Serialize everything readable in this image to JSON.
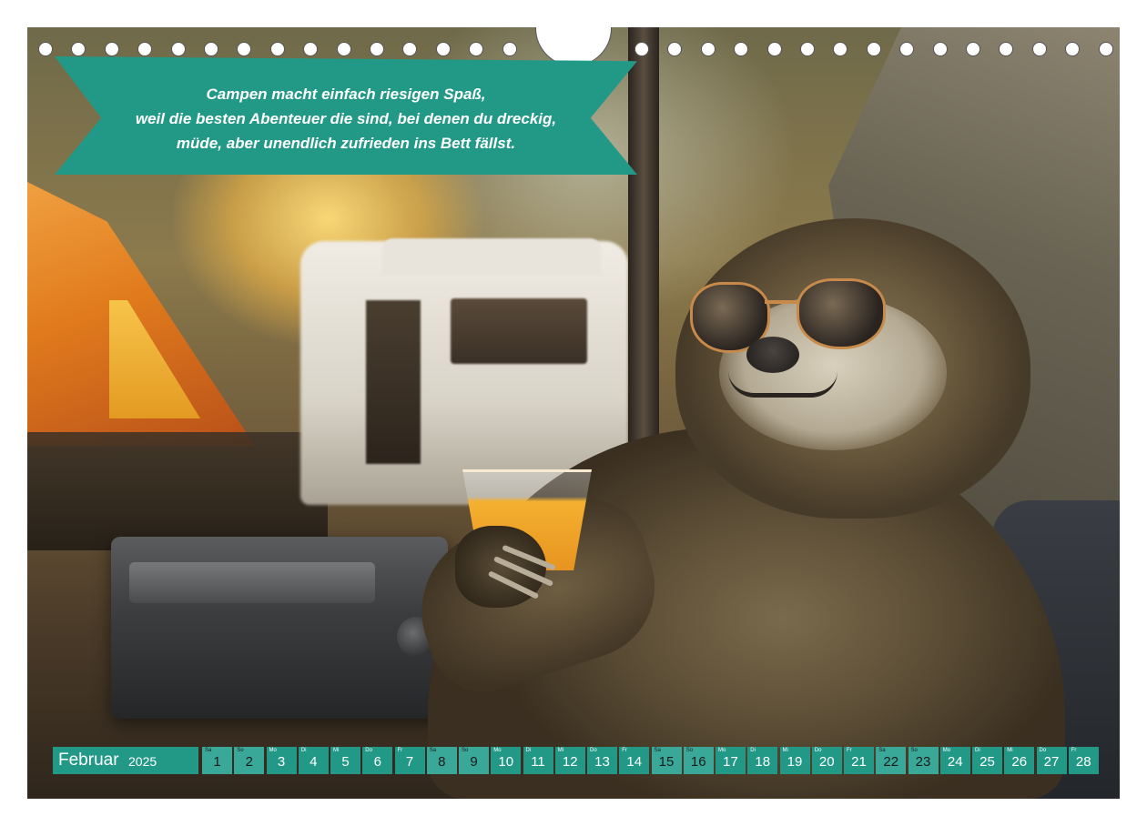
{
  "banner": {
    "lines": [
      "Campen macht einfach riesigen Spaß,",
      "weil die besten Abenteuer die sind, bei denen du dreckig,",
      "müde, aber unendlich zufrieden ins Bett fällst."
    ]
  },
  "calendar": {
    "month": "Februar",
    "year": "2025",
    "days": [
      {
        "wd": "Sa",
        "num": "1"
      },
      {
        "wd": "So",
        "num": "2"
      },
      {
        "wd": "Mo",
        "num": "3"
      },
      {
        "wd": "Di",
        "num": "4"
      },
      {
        "wd": "Mi",
        "num": "5"
      },
      {
        "wd": "Do",
        "num": "6"
      },
      {
        "wd": "Fr",
        "num": "7"
      },
      {
        "wd": "Sa",
        "num": "8"
      },
      {
        "wd": "So",
        "num": "9"
      },
      {
        "wd": "Mo",
        "num": "10"
      },
      {
        "wd": "Di",
        "num": "11"
      },
      {
        "wd": "Mi",
        "num": "12"
      },
      {
        "wd": "Do",
        "num": "13"
      },
      {
        "wd": "Fr",
        "num": "14"
      },
      {
        "wd": "Sa",
        "num": "15"
      },
      {
        "wd": "So",
        "num": "16"
      },
      {
        "wd": "Mo",
        "num": "17"
      },
      {
        "wd": "Di",
        "num": "18"
      },
      {
        "wd": "Mi",
        "num": "19"
      },
      {
        "wd": "Do",
        "num": "20"
      },
      {
        "wd": "Fr",
        "num": "21"
      },
      {
        "wd": "Sa",
        "num": "22"
      },
      {
        "wd": "So",
        "num": "23"
      },
      {
        "wd": "Mo",
        "num": "24"
      },
      {
        "wd": "Di",
        "num": "25"
      },
      {
        "wd": "Mi",
        "num": "26"
      },
      {
        "wd": "Do",
        "num": "27"
      },
      {
        "wd": "Fr",
        "num": "28"
      }
    ]
  },
  "colors": {
    "accent": "#229987",
    "weekend": "#3aa898"
  }
}
